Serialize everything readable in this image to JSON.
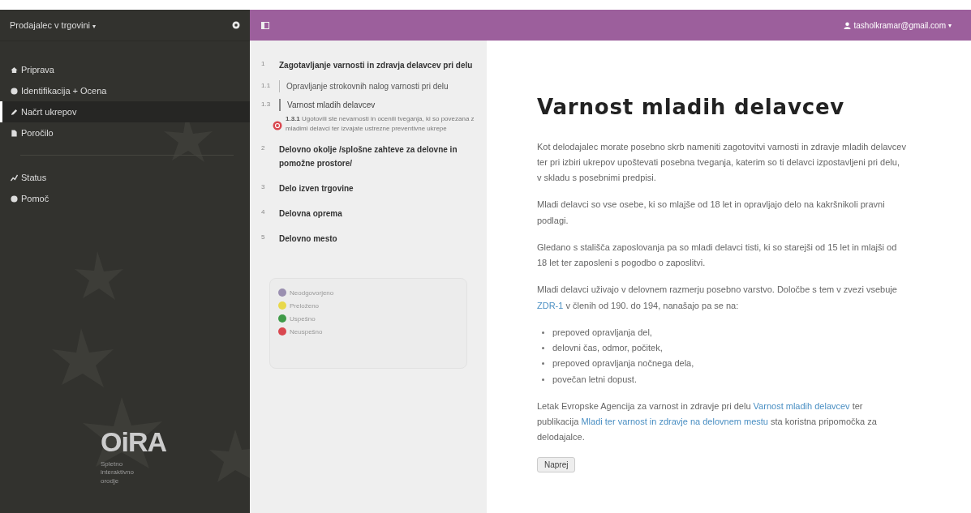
{
  "sidebar": {
    "title": "Prodajalec v trgovini",
    "title_caret": "▾",
    "items": [
      {
        "label": "Priprava",
        "selected": false
      },
      {
        "label": "Identifikacija + Ocena",
        "selected": false
      },
      {
        "label": "Načrt ukrepov",
        "selected": true
      },
      {
        "label": "Poročilo",
        "selected": false
      }
    ],
    "items2": [
      {
        "label": "Status",
        "selected": false
      },
      {
        "label": "Pomoč",
        "selected": false
      }
    ],
    "logo": "OiRA",
    "logo_subtitle": "Spletno interaktivno orodje"
  },
  "topbar": {
    "user": "tasholkramar@gmail.com",
    "user_caret": "▾"
  },
  "tree": [
    {
      "number": "1",
      "label": "Zagotavljanje varnosti in zdravja delavcev pri delu",
      "children": [
        {
          "number": "1.1",
          "label": "Opravljanje strokovnih nalog varnosti pri delu",
          "selected": false
        },
        {
          "number": "1.3",
          "label": "Varnost mladih delavcev",
          "selected": true,
          "children": [
            {
              "number": "1.3.1",
              "label": "Ugotovili ste nevarnosti in ocenili tveganja, ki so povezana z mladimi delavci ter izvajate ustrezne preventivne ukrepe",
              "kind": "failed"
            }
          ]
        }
      ]
    },
    {
      "number": "2",
      "label": "Delovno okolje /splošne zahteve za delovne in pomožne prostore/"
    },
    {
      "number": "3",
      "label": "Delo izven trgovine"
    },
    {
      "number": "4",
      "label": "Delovna oprema"
    },
    {
      "number": "5",
      "label": "Delovno mesto"
    }
  ],
  "legend": [
    {
      "label": "Neodgovorjeno",
      "color": "#9a8fb0"
    },
    {
      "label": "Preloženo",
      "color": "#e8d84a"
    },
    {
      "label": "Uspešno",
      "color": "#3f9a48"
    },
    {
      "label": "Neuspešno",
      "color": "#d9474f"
    }
  ],
  "content": {
    "title": "Varnost mladih delavcev",
    "paragraphs": [
      [
        {
          "text": "Kot delodajalec morate posebno skrb nameniti zagotovitvi varnosti in zdravje mladih delavcev ter pri izbiri ukrepov upoštevati posebna tveganja, katerim so ti delavci izpostavljeni pri delu, v skladu s posebnimi predpisi."
        }
      ],
      [
        {
          "text": "Mladi delavci so vse osebe, ki so mlajše od 18 let in opravljajo delo na kakršnikoli pravni podlagi."
        }
      ],
      [
        {
          "text": "Gledano s stališča zaposlovanja pa so mladi delavci tisti, ki so starejši od 15 let in mlajši od 18 let ter zaposleni s pogodbo o zaposlitvi."
        }
      ],
      [
        {
          "text": "Mladi delavci uživajo v delovnem razmerju posebno varstvo. Določbe s tem v zvezi vsebuje "
        },
        {
          "link": "ZDR-1"
        },
        {
          "text": " v členih od 190. do 194, nanašajo pa se na:"
        }
      ]
    ],
    "bullets": [
      "prepoved opravljanja del,",
      "delovni čas, odmor, počitek,",
      "prepoved opravljanja nočnega dela,",
      "povečan letni dopust."
    ],
    "closing": [
      {
        "text": "Letak Evropske Agencija za varnost in zdravje pri delu "
      },
      {
        "link": "Varnost mladih delavcev"
      },
      {
        "text": " ter publikacija "
      },
      {
        "link": "Mladi ter varnost in zdravje na delovnem mestu"
      },
      {
        "text": " sta koristna pripomočka za delodajalce."
      }
    ],
    "button": "Naprej"
  }
}
